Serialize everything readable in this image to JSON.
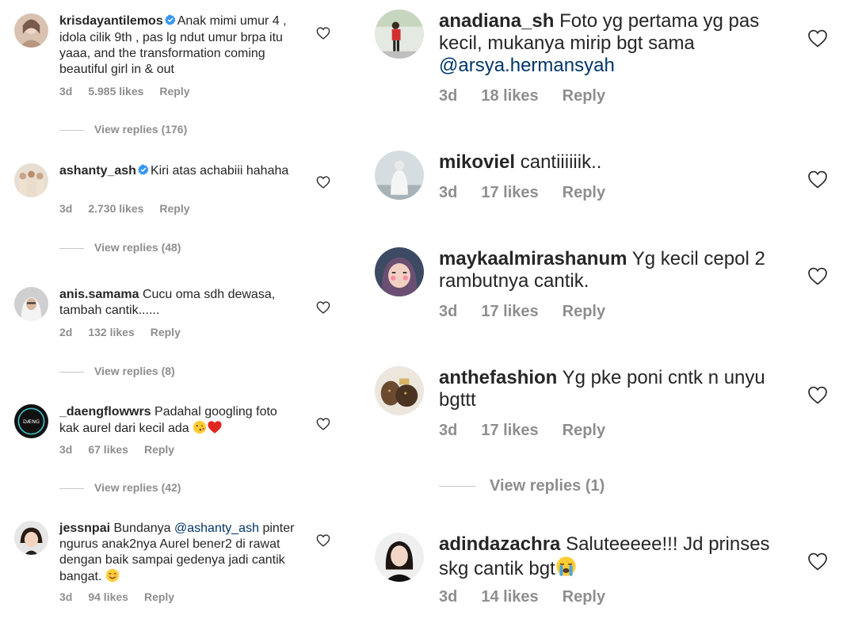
{
  "left": {
    "comments": [
      {
        "username": "krisdayantilemos",
        "verified": true,
        "text": "Anak mimi umur 4 , idola cilik 9th , pas lg ndut umur brpa itu yaaa, and the transformation coming beautiful girl in & out",
        "time": "3d",
        "likes": "5.985 likes",
        "reply": "Reply",
        "view_replies": "View replies (176)"
      },
      {
        "username": "ashanty_ash",
        "verified": true,
        "text": "Kiri atas achabiii hahaha",
        "time": "3d",
        "likes": "2.730 likes",
        "reply": "Reply",
        "view_replies": "View replies (48)"
      },
      {
        "username": "anis.samama",
        "verified": false,
        "text": "Cucu oma sdh dewasa, tambah cantik......",
        "time": "2d",
        "likes": "132 likes",
        "reply": "Reply",
        "view_replies": "View replies (8)"
      },
      {
        "username": "_daengflowwrs",
        "verified": false,
        "text": "Padahal googling foto kak aurel dari kecil ada",
        "emoji": [
          "kissing-face-emoji",
          "red-heart-emoji"
        ],
        "time": "3d",
        "likes": "67 likes",
        "reply": "Reply",
        "view_replies": "View replies (42)"
      },
      {
        "username": "jessnpai",
        "verified": false,
        "text_pre": "Bundanya",
        "mention": "@ashanty_ash",
        "text_post": "pinter ngurus anak2nya Aurel bener2 di rawat dengan baik sampai gedenya jadi cantik bangat.",
        "emoji": [
          "smiling-face-emoji"
        ],
        "time": "3d",
        "likes": "94 likes",
        "reply": "Reply"
      }
    ]
  },
  "right": {
    "comments": [
      {
        "username": "anadiana_sh",
        "text_pre": "Foto yg pertama yg pas kecil, mukanya mirip bgt sama",
        "mention": "@arsya.hermansyah",
        "time": "3d",
        "likes": "18 likes",
        "reply": "Reply"
      },
      {
        "username": "mikoviel",
        "text": "cantiiiiiik..",
        "time": "3d",
        "likes": "17 likes",
        "reply": "Reply"
      },
      {
        "username": "maykaalmirashanum",
        "text": "Yg kecil cepol 2 rambutnya cantik.",
        "time": "3d",
        "likes": "17 likes",
        "reply": "Reply"
      },
      {
        "username": "anthefashion",
        "text": "Yg pke poni cntk n unyu bgttt",
        "time": "3d",
        "likes": "17 likes",
        "reply": "Reply",
        "view_replies": "View replies (1)"
      },
      {
        "username": "adindazachra",
        "text": "Saluteeeee!!! Jd prinses skg cantik bgt",
        "emoji": [
          "crying-face-emoji"
        ],
        "time": "3d",
        "likes": "14 likes",
        "reply": "Reply"
      }
    ]
  },
  "colors": {
    "text": "#262626",
    "muted": "#8e8e8e",
    "mention": "#003569",
    "verified": "#3897f0",
    "heart": "#262626"
  }
}
